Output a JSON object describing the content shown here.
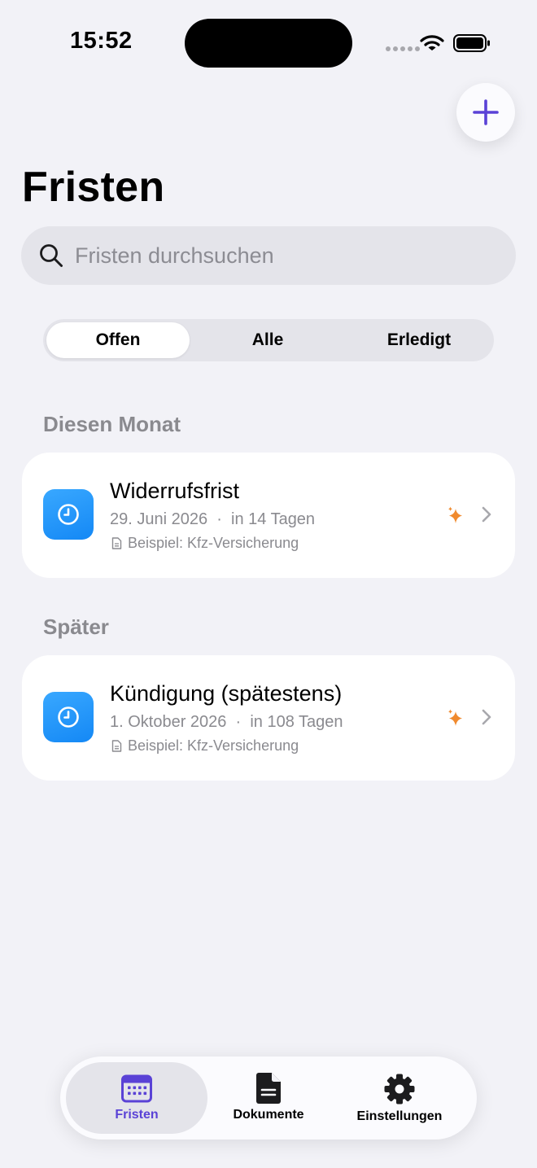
{
  "status_bar": {
    "time": "15:52"
  },
  "header": {
    "title": "Fristen",
    "add_icon": "plus-icon"
  },
  "search": {
    "placeholder": "Fristen durchsuchen",
    "value": ""
  },
  "filter": {
    "segments": [
      {
        "label": "Offen",
        "selected": true
      },
      {
        "label": "Alle",
        "selected": false
      },
      {
        "label": "Erledigt",
        "selected": false
      }
    ]
  },
  "sections": [
    {
      "header": "Diesen Monat",
      "items": [
        {
          "title": "Widerrufsfrist",
          "date": "29. Juni 2026",
          "relative": "in 14 Tagen",
          "document": "Beispiel: Kfz-Versicherung",
          "icon": "clock-icon"
        }
      ]
    },
    {
      "header": "Später",
      "items": [
        {
          "title": "Kündigung (spätestens)",
          "date": "1. Oktober 2026",
          "relative": "in 108 Tagen",
          "document": "Beispiel: Kfz-Versicherung",
          "icon": "clock-icon"
        }
      ]
    }
  ],
  "tabbar": {
    "tabs": [
      {
        "label": "Fristen",
        "icon": "calendar-icon",
        "active": true
      },
      {
        "label": "Dokumente",
        "icon": "document-icon",
        "active": false
      },
      {
        "label": "Einstellungen",
        "icon": "gear-icon",
        "active": false
      }
    ]
  },
  "colors": {
    "accent": "#5A42D6",
    "icon_blue": "#1E90FF",
    "sparkle": "#F08A2E",
    "background": "#F2F2F7",
    "secondary_text": "#8A8A8F"
  }
}
